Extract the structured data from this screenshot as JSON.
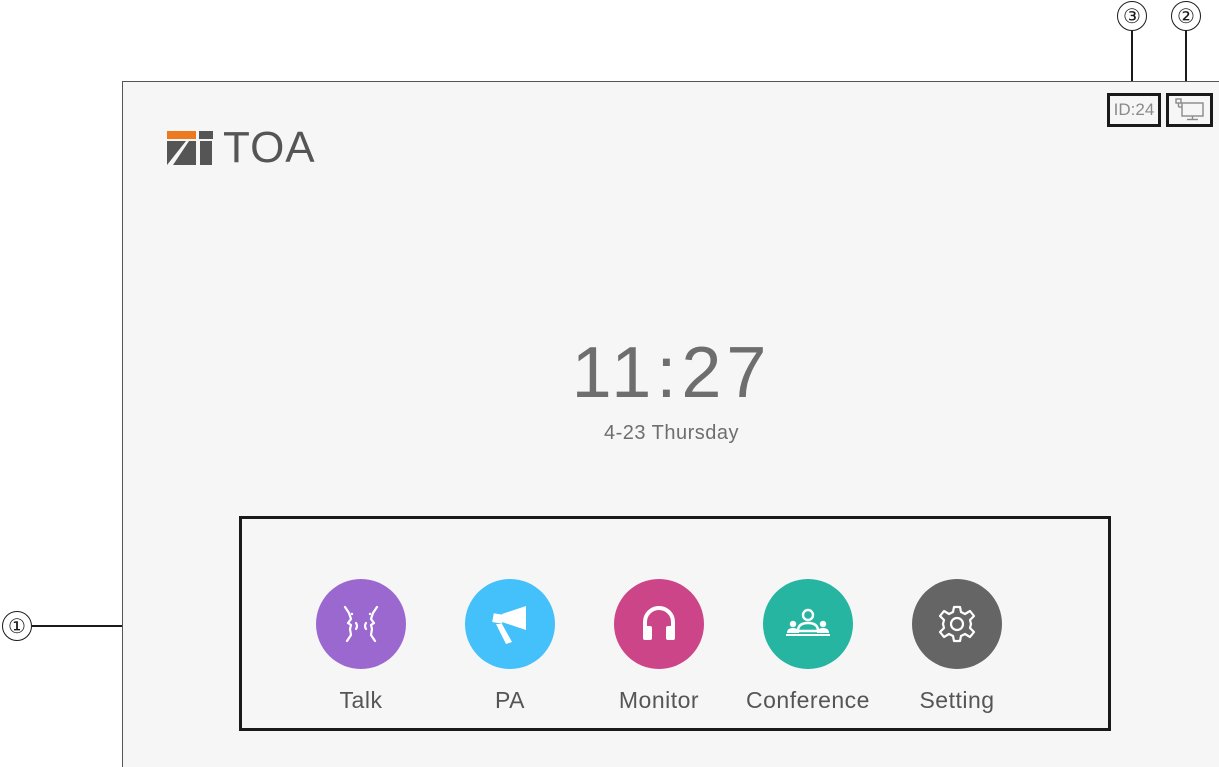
{
  "brand": {
    "name": "TOA",
    "logo_colors": {
      "orange": "#ee7a1f",
      "gray": "#555555"
    }
  },
  "status": {
    "id_label": "ID:24",
    "network_icon": "network-computer-icon"
  },
  "clock": {
    "time": "11:27",
    "date": "4-23 Thursday"
  },
  "functions": [
    {
      "label": "Talk",
      "icon": "talk-faces-icon",
      "color": "#9b68cf"
    },
    {
      "label": "PA",
      "icon": "megaphone-icon",
      "color": "#44c0fb"
    },
    {
      "label": "Monitor",
      "icon": "headphones-icon",
      "color": "#cc4588"
    },
    {
      "label": "Conference",
      "icon": "conference-group-icon",
      "color": "#26b5a0"
    },
    {
      "label": "Setting",
      "icon": "gear-icon",
      "color": "#656565"
    }
  ],
  "callouts": {
    "functions": "①",
    "network": "②",
    "id": "③"
  }
}
